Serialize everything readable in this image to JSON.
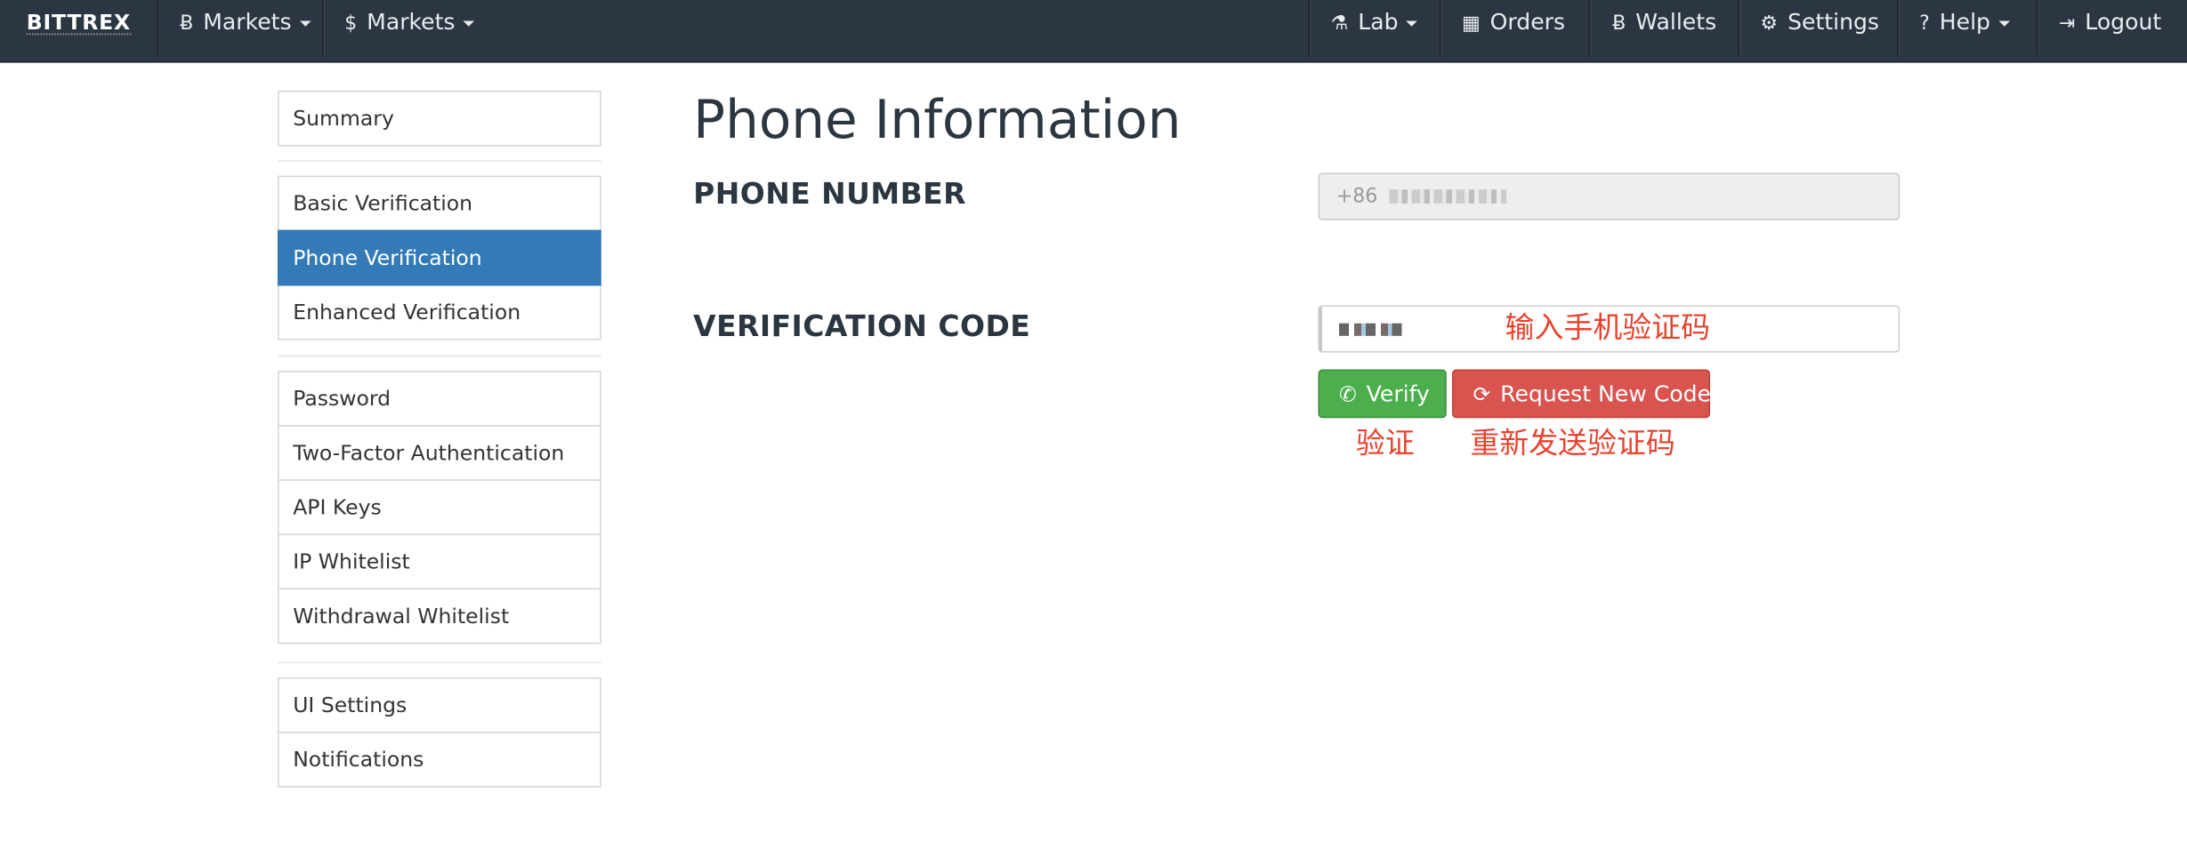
{
  "navbar": {
    "brand": "BITTREX",
    "left_items": [
      {
        "label": "Markets",
        "icon": "bitcoin-icon",
        "glyph": "Ƀ"
      },
      {
        "label": "Markets",
        "icon": "dollar-icon",
        "glyph": "$"
      }
    ],
    "right_items": [
      {
        "label": "Lab",
        "icon": "flask-icon",
        "glyph": "⚗"
      },
      {
        "label": "Orders",
        "icon": "calendar-icon",
        "glyph": "▦"
      },
      {
        "label": "Wallets",
        "icon": "bitcoin-icon",
        "glyph": "Ƀ"
      },
      {
        "label": "Settings",
        "icon": "gear-icon",
        "glyph": "⚙"
      },
      {
        "label": "Help",
        "icon": "question-circle-icon",
        "glyph": "?"
      },
      {
        "label": "Logout",
        "icon": "logout-icon",
        "glyph": "⇥"
      }
    ]
  },
  "sidebar": {
    "groups": [
      [
        "Summary"
      ],
      [
        "Basic Verification",
        "Phone Verification",
        "Enhanced Verification"
      ],
      [
        "Password",
        "Two-Factor Authentication",
        "API Keys",
        "IP Whitelist",
        "Withdrawal Whitelist"
      ],
      [
        "UI Settings",
        "Notifications"
      ]
    ],
    "active": "Phone Verification"
  },
  "main": {
    "title": "Phone Information",
    "phone_label": "PHONE NUMBER",
    "phone_value_prefix": "+86",
    "code_label": "VERIFICATION CODE",
    "verify_button": "Verify",
    "request_button": "Request New Code"
  },
  "annotations": {
    "input_hint": "输入手机验证码",
    "verify_hint": "验证",
    "resend_hint": "重新发送验证码"
  },
  "colors": {
    "navbar": "#2c3642",
    "active": "#337ab7",
    "verify": "#4cae4c",
    "request": "#d9534f",
    "annotation": "#e8432e"
  }
}
